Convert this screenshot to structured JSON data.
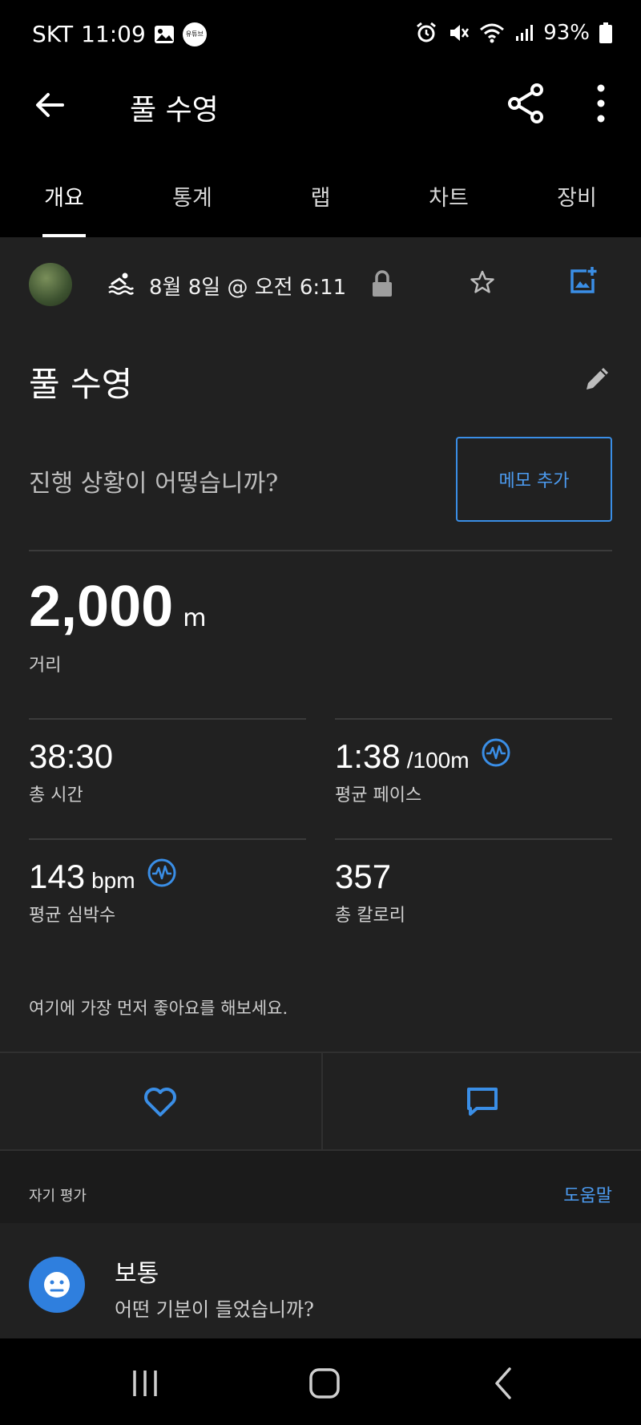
{
  "status_bar": {
    "carrier": "SKT",
    "time": "11:09",
    "badge_text": "유튜브",
    "battery": "93%"
  },
  "header": {
    "title": "풀 수영"
  },
  "tabs": [
    {
      "label": "개요",
      "active": true
    },
    {
      "label": "통계",
      "active": false
    },
    {
      "label": "랩",
      "active": false
    },
    {
      "label": "차트",
      "active": false
    },
    {
      "label": "장비",
      "active": false
    }
  ],
  "activity": {
    "date": "8월 8일 @ 오전 6:11",
    "title": "풀 수영",
    "prompt": "진행 상황이 어떻습니까?",
    "memo_button": "메모 추가"
  },
  "stats": {
    "distance": {
      "value": "2,000",
      "unit": "m",
      "label": "거리"
    },
    "total_time": {
      "value": "38:30",
      "label": "총 시간"
    },
    "avg_pace": {
      "value": "1:38",
      "unit": "/100m",
      "label": "평균 페이스"
    },
    "avg_hr": {
      "value": "143",
      "unit": "bpm",
      "label": "평균 심박수"
    },
    "calories": {
      "value": "357",
      "label": "총 칼로리"
    }
  },
  "kudos_prompt": "여기에 가장 먼저 좋아요를 해보세요.",
  "self_evaluation": {
    "title": "자기 평가",
    "help": "도움말",
    "feel_title": "보통",
    "feel_subtitle": "어떤 기분이 들었습니까?"
  },
  "colors": {
    "accent": "#3a8ee6",
    "background": "#212121",
    "header_bg": "#000000"
  }
}
